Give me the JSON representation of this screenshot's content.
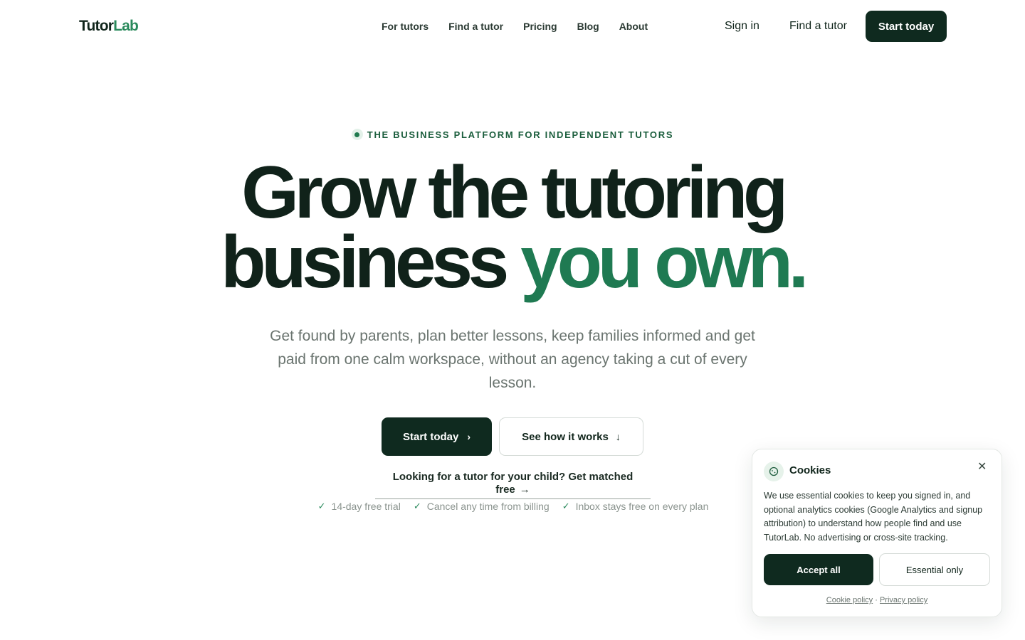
{
  "brand": {
    "logo_part1": "Tutor",
    "logo_part2": "Lab",
    "accent_color": "#2a8a5c",
    "dark_color": "#0f2a1f"
  },
  "nav": {
    "items": [
      {
        "label": "For tutors"
      },
      {
        "label": "Find a tutor"
      },
      {
        "label": "Pricing"
      },
      {
        "label": "Blog"
      },
      {
        "label": "About"
      }
    ],
    "sign_in": "Sign in",
    "find_tutor": "Find a tutor",
    "cta": "Start today"
  },
  "hero": {
    "eyebrow": "THE BUSINESS PLATFORM FOR INDEPENDENT TUTORS",
    "headline_line1": "Grow the tutoring",
    "headline_line2_a": "business ",
    "headline_line2_b": "you own.",
    "subtitle": "Get found by parents, plan better lessons, keep families informed and get paid from one calm workspace, without an agency taking a cut of every lesson.",
    "primary_cta": "Start today",
    "primary_cta_icon": "chevron-right-icon",
    "secondary_cta": "See how it works",
    "secondary_cta_icon": "arrow-down-icon",
    "parent_link": "Looking for a tutor for your child? Get matched free",
    "parent_link_icon": "arrow-right-icon",
    "checks": [
      {
        "label": "14-day free trial"
      },
      {
        "label": "Cancel any time from billing"
      },
      {
        "label": "Inbox stays free on every plan"
      }
    ]
  },
  "cookie": {
    "icon": "cookie-icon",
    "title": "Cookies",
    "close_icon": "close-icon",
    "text": "We use essential cookies to keep you signed in, and optional analytics cookies (Google Analytics and signup attribution) to understand how people find and use TutorLab. No advertising or cross-site tracking.",
    "accept": "Accept all",
    "essential": "Essential only",
    "cookie_policy": "Cookie policy",
    "separator": " · ",
    "privacy_policy": "Privacy policy"
  }
}
